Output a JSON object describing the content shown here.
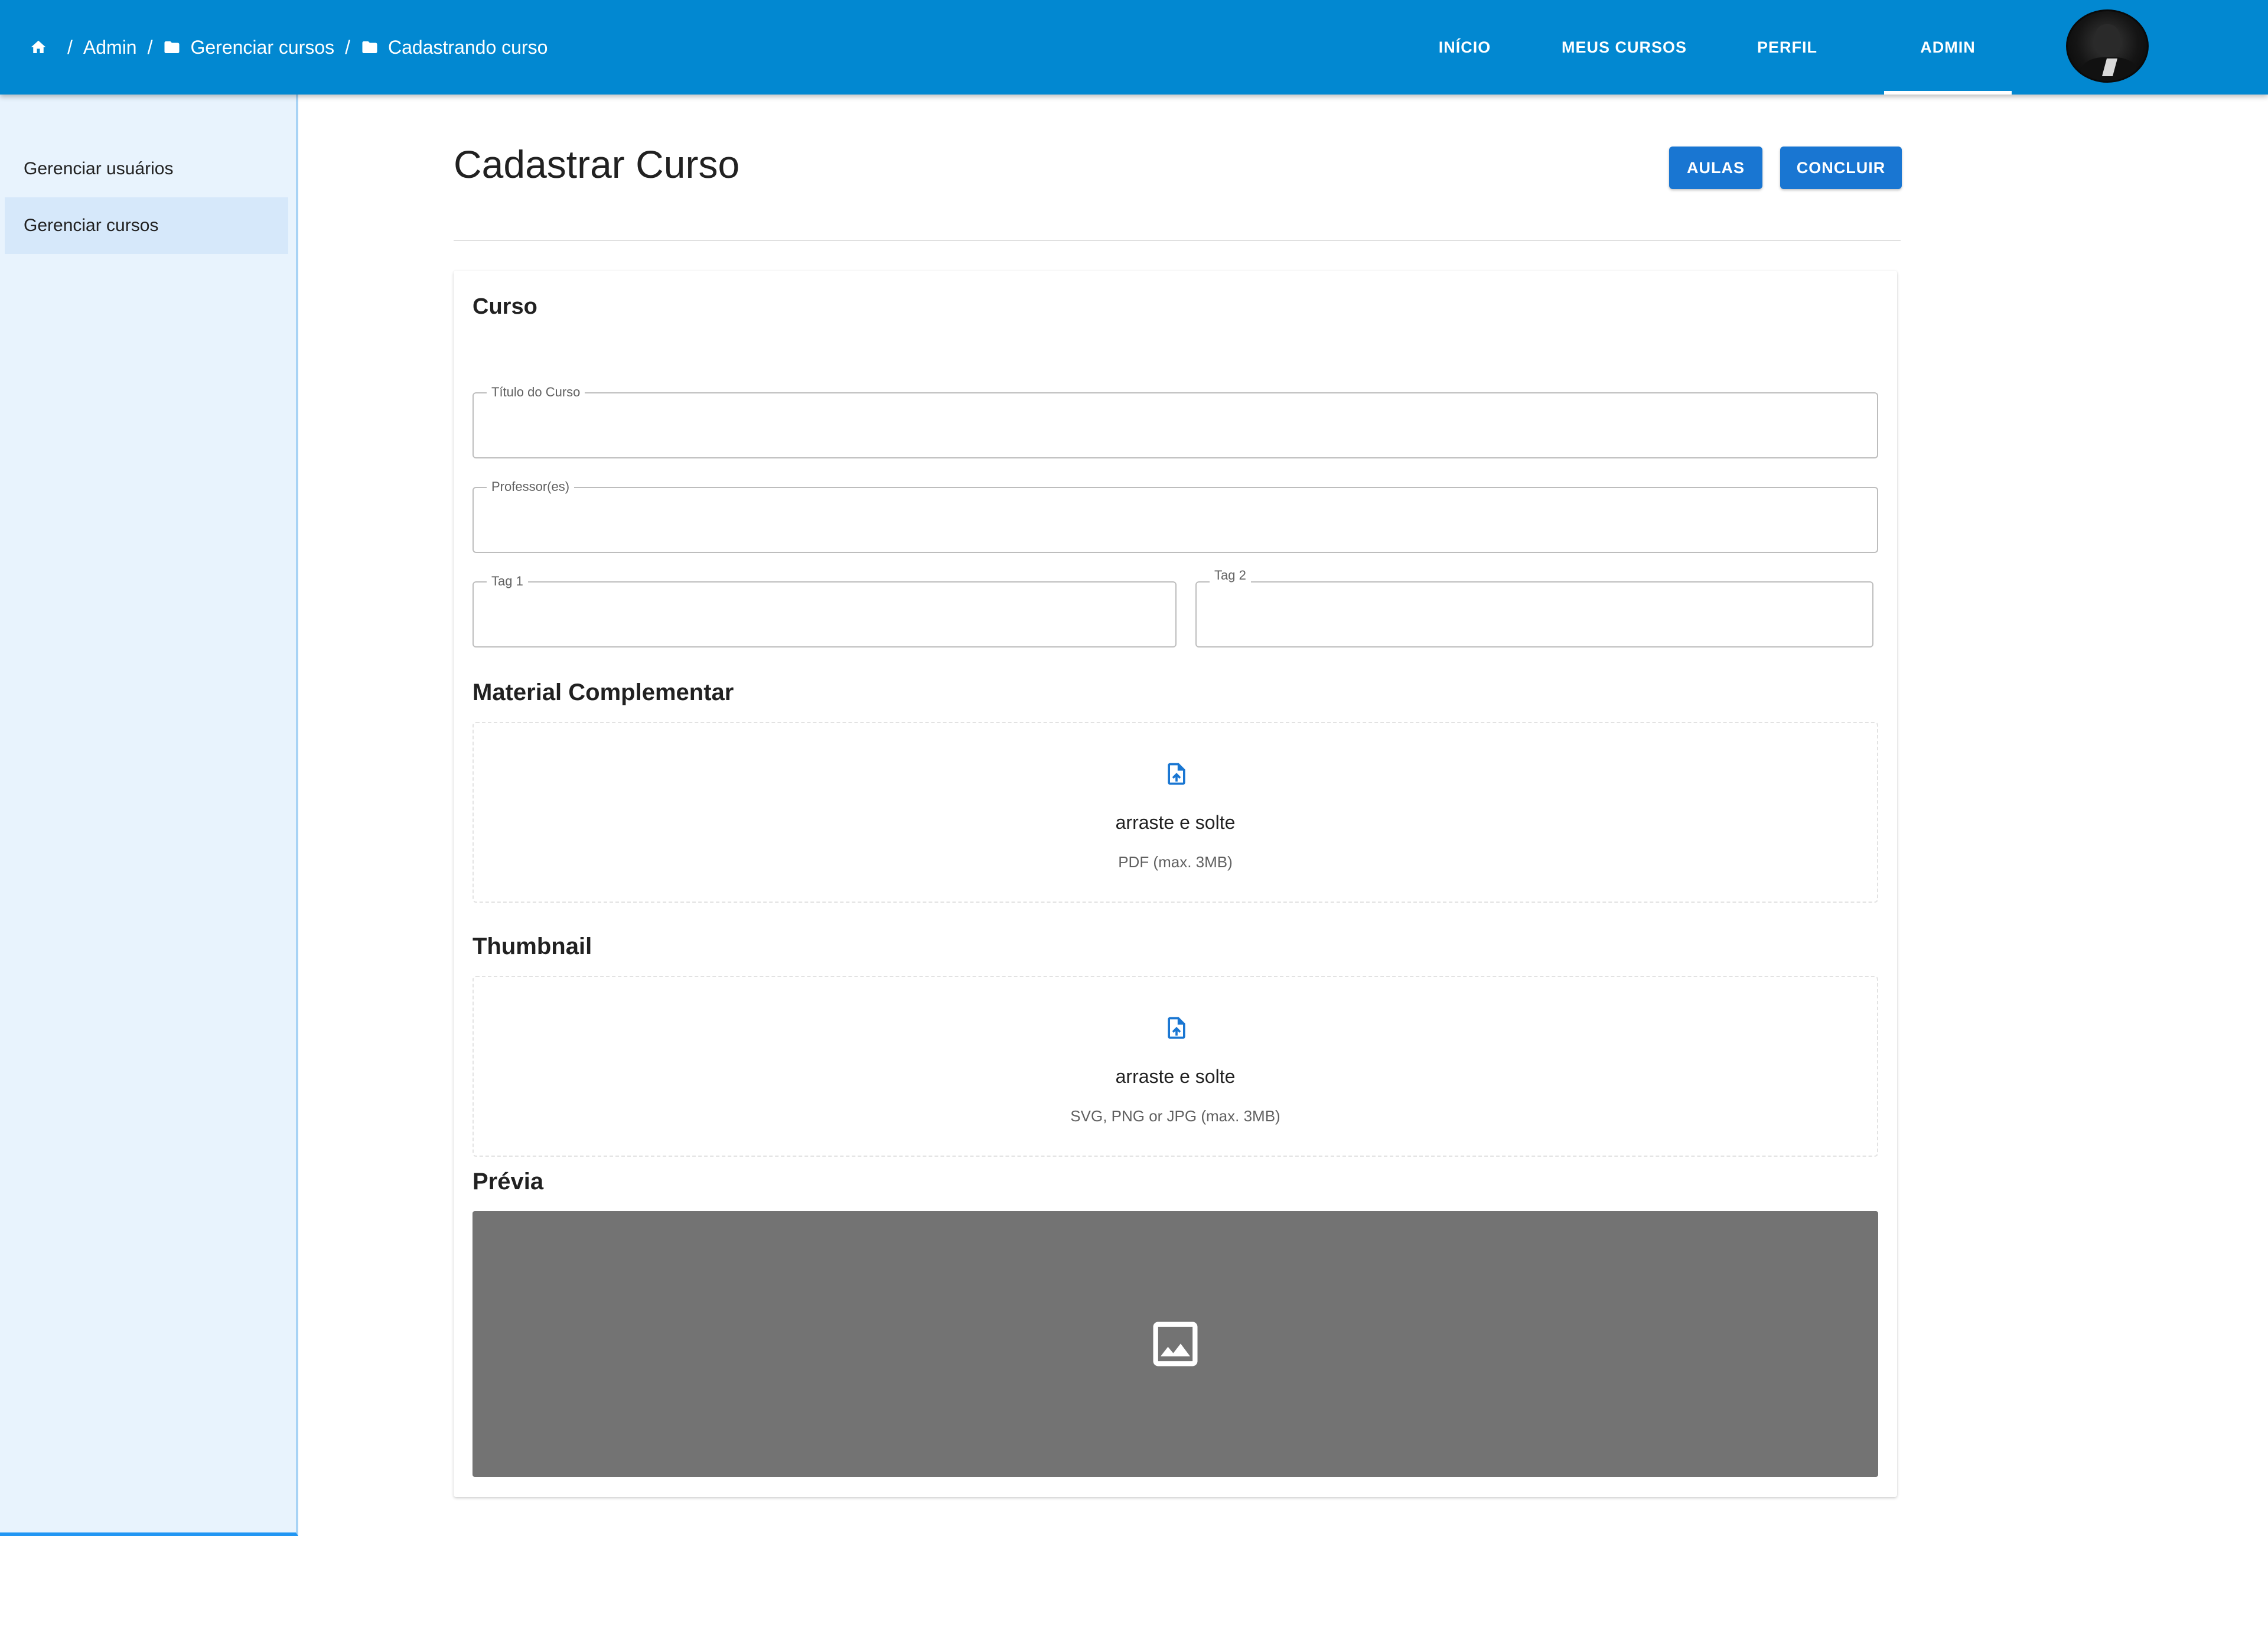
{
  "breadcrumb": {
    "items": [
      "Admin",
      "Gerenciar cursos",
      "Cadastrando curso"
    ],
    "separator": "/"
  },
  "nav": {
    "items": [
      "INÍCIO",
      "MEUS CURSOS",
      "PERFIL",
      "ADMIN"
    ],
    "active": "ADMIN"
  },
  "sidebar": {
    "items": [
      {
        "label": "Gerenciar usuários",
        "selected": false
      },
      {
        "label": "Gerenciar cursos",
        "selected": true
      }
    ]
  },
  "page": {
    "title": "Cadastrar Curso",
    "buttons": {
      "aulas": "AULAS",
      "concluir": "CONCLUIR"
    }
  },
  "form": {
    "section_title": "Curso",
    "fields": {
      "titulo": {
        "label": "Título do Curso",
        "value": ""
      },
      "professores": {
        "label": "Professor(es)",
        "value": ""
      },
      "tag1": {
        "label": "Tag 1",
        "value": ""
      },
      "tag2": {
        "label": "Tag 2",
        "value": ""
      }
    },
    "material": {
      "title": "Material Complementar",
      "drop_text": "arraste e solte",
      "hint": "PDF (max. 3MB)"
    },
    "thumbnail": {
      "title": "Thumbnail",
      "drop_text": "arraste e solte",
      "hint": "SVG, PNG or JPG (max. 3MB)"
    },
    "preview": {
      "title": "Prévia"
    }
  },
  "colors": {
    "appbar": "#0288d1",
    "button": "#1976d2",
    "sidebar_bg": "#e8f3fd",
    "sidebar_selected": "#d6e8fa",
    "preview_bg": "#737373"
  },
  "icons": {
    "home": "home-icon",
    "folder": "folder-icon",
    "upload": "file-upload-icon",
    "image": "image-placeholder-icon"
  }
}
